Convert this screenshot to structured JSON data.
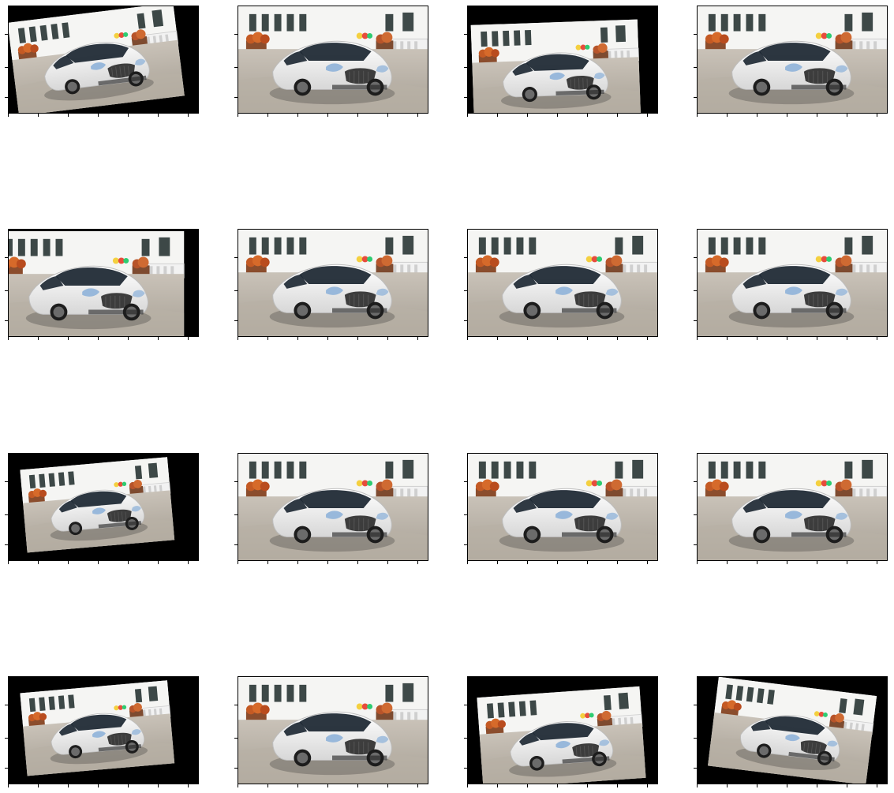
{
  "figure": {
    "grid": {
      "rows": 4,
      "cols": 4
    },
    "background": "#ffffff",
    "panels": [
      {
        "id": "p1",
        "variant": "rotated-left-small"
      },
      {
        "id": "p2",
        "variant": "original"
      },
      {
        "id": "p3",
        "variant": "rotated-slight-letterbox"
      },
      {
        "id": "p4",
        "variant": "original"
      },
      {
        "id": "p5",
        "variant": "shifted"
      },
      {
        "id": "p6",
        "variant": "original"
      },
      {
        "id": "p7",
        "variant": "original"
      },
      {
        "id": "p8",
        "variant": "original"
      },
      {
        "id": "p9",
        "variant": "rotated-small"
      },
      {
        "id": "p10",
        "variant": "original"
      },
      {
        "id": "p11",
        "variant": "original"
      },
      {
        "id": "p12",
        "variant": "original"
      },
      {
        "id": "p13",
        "variant": "rotated-small"
      },
      {
        "id": "p14",
        "variant": "original"
      },
      {
        "id": "p15",
        "variant": "rotated-right"
      },
      {
        "id": "p16",
        "variant": "rotated-right-small"
      }
    ]
  }
}
